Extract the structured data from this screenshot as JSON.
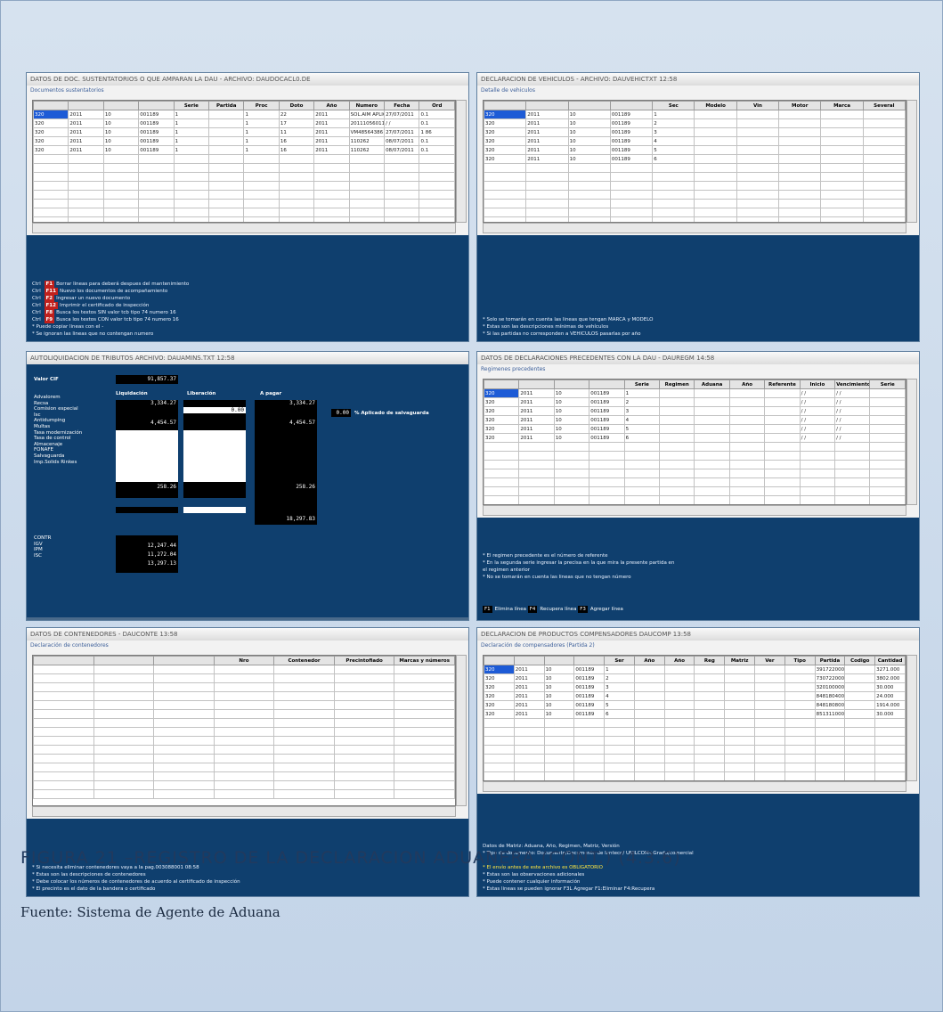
{
  "figure": {
    "caption": "FIGURA 21 –REGISTRO DE LA DECLARACION ADUANERA  (CONT.) (4.3.6)",
    "source": "Fuente: Sistema de Agente de Aduana"
  },
  "panels": {
    "p1": {
      "title": "DATOS DE DOC. SUSTENTATORIOS O QUE AMPARAN LA DAU - ARCHIVO: DAUDOCACL0.DE",
      "section": "Documentos sustentatorios",
      "columns": [
        "",
        "",
        "",
        "",
        "Serie",
        "Partida",
        "Proc",
        "Doto",
        "Año",
        "Numero",
        "Fecha",
        "Ord"
      ],
      "rows": [
        [
          "320",
          "2011",
          "10",
          "001189",
          "1",
          "",
          "1",
          "22",
          "2011",
          "SOL.AIM APLICACION 9210912",
          "27/07/2011",
          "0.1"
        ],
        [
          "320",
          "2011",
          "10",
          "001189",
          "1",
          "",
          "1",
          "17",
          "2011",
          "2011105601186",
          "/ /",
          "0.1"
        ],
        [
          "320",
          "2011",
          "10",
          "001189",
          "1",
          "",
          "1",
          "11",
          "2011",
          "VM48564386",
          "27/07/2011",
          "1 86"
        ],
        [
          "320",
          "2011",
          "10",
          "001189",
          "1",
          "",
          "1",
          "16",
          "2011",
          "110262",
          "08/07/2011",
          "0.1"
        ],
        [
          "320",
          "2011",
          "10",
          "001189",
          "1",
          "",
          "1",
          "16",
          "2011",
          "110262",
          "08/07/2011",
          "0.1"
        ]
      ],
      "notes": [
        {
          "key": "F1",
          "text": "Ctrl  Borrar lineas para deberá despues del mantenimiento"
        },
        {
          "key": "F11",
          "text": "Ctrl  Nuevo los documentos de acompañamiento"
        },
        {
          "key": "F2",
          "text": "Ctrl  Ingresar un nuevo documento"
        },
        {
          "key": "F12",
          "text": "Ctrl  Imprimir el certificado de inspección"
        },
        {
          "key": "F8",
          "text": "Ctrl  Busca los textos SIN valor tcb tipo 74 numero 16"
        },
        {
          "key": "F9",
          "text": "Ctrl  Busca los textos CON valor tcb tipo 74 numero 16"
        },
        {
          "key": "",
          "text": "* Puede copiar lineas con el -"
        },
        {
          "key": "",
          "text": "* Se ignoran las lineas que no contengan numero"
        }
      ]
    },
    "p2": {
      "title": "DECLARACION DE VEHICULOS - ARCHIVO: DAUVEHICTXT 12:58",
      "section": "Detalle de vehiculos",
      "columns": [
        "",
        "",
        "",
        "",
        "Sec",
        "Modelo",
        "Vin",
        "Motor",
        "Marca",
        "Several"
      ],
      "rows": [
        [
          "320",
          "2011",
          "10",
          "001189",
          "1",
          "",
          "",
          "",
          "",
          ""
        ],
        [
          "320",
          "2011",
          "10",
          "001189",
          "2",
          "",
          "",
          "",
          "",
          ""
        ],
        [
          "320",
          "2011",
          "10",
          "001189",
          "3",
          "",
          "",
          "",
          "",
          ""
        ],
        [
          "320",
          "2011",
          "10",
          "001189",
          "4",
          "",
          "",
          "",
          "",
          ""
        ],
        [
          "320",
          "2011",
          "10",
          "001189",
          "5",
          "",
          "",
          "",
          "",
          ""
        ],
        [
          "320",
          "2011",
          "10",
          "001189",
          "6",
          "",
          "",
          "",
          "",
          ""
        ]
      ],
      "notes": [
        "* Solo se tomarán en cuenta las lineas que tengan MARCA y MODELO",
        "* Estas son las descripciones mínimas de vehículos",
        "* Si las partidas no corresponden a VEHICULOS pasarlas por año"
      ]
    },
    "p3": {
      "title": "AUTOLIQUIDACION DE TRIBUTOS  ARCHIVO: DAUAMINS.TXT 12:58",
      "valor_label": "Valor CIF",
      "valor": "91,857.37",
      "headers": {
        "liq": "Liquidación",
        "lib": "Liberación",
        "pagar": "A pagar"
      },
      "labels": [
        "Advalorem",
        "Recsa",
        "Comision especial",
        "Isc",
        "Antidumping",
        "Multas",
        "Tasa modernización",
        "Tasa de control",
        "Almacenaje",
        "FONAFE",
        "Salvaguarda",
        "Imp.Solids Rinkes"
      ],
      "advalorem_liq": "3,334.27",
      "advalorem_pagar": "3,334.27",
      "recsa_lib": "0.00",
      "isc_liq": "4,454.57",
      "isc_pagar": "4,454.57",
      "fonafe_liq": "258.26",
      "fonafe_pagar": "258.26",
      "total_pagar": "18,297.83",
      "pct_value": "0.00",
      "pct_label": "% Aplicado de salvaguarda",
      "bottom_labels": [
        "CONTR",
        "IGV",
        "IPM",
        "ISC"
      ],
      "bottom_values": [
        "12,247.44",
        "11,272.04",
        "13,297.13"
      ]
    },
    "p4": {
      "title": "DATOS DE DECLARACIONES PRECEDENTES CON LA DAU - DAUREGM 14:58",
      "section": "Regimenes precedentes",
      "columns": [
        "",
        "",
        "",
        "",
        "Serie",
        "Regimen",
        "Aduana",
        "Año",
        "Referente",
        "Inicio",
        "Vencimiento",
        "Serie"
      ],
      "rows": [
        [
          "320",
          "2011",
          "10",
          "001189",
          "1",
          "",
          "",
          "",
          "",
          "/ /",
          "/ /",
          ""
        ],
        [
          "320",
          "2011",
          "10",
          "001189",
          "2",
          "",
          "",
          "",
          "",
          "/ /",
          "/ /",
          ""
        ],
        [
          "320",
          "2011",
          "10",
          "001189",
          "3",
          "",
          "",
          "",
          "",
          "/ /",
          "/ /",
          ""
        ],
        [
          "320",
          "2011",
          "10",
          "001189",
          "4",
          "",
          "",
          "",
          "",
          "/ /",
          "/ /",
          ""
        ],
        [
          "320",
          "2011",
          "10",
          "001189",
          "5",
          "",
          "",
          "",
          "",
          "/ /",
          "/ /",
          ""
        ],
        [
          "320",
          "2011",
          "10",
          "001189",
          "6",
          "",
          "",
          "",
          "",
          "/ /",
          "/ /",
          ""
        ]
      ],
      "notes": [
        "* El regimen precedente es el número de referente",
        "* En la segunda serie ingresar la precisa en la que mira la presente partida en",
        "  el regimen anterior",
        "* No se tomarán en cuenta las lineas que no tengan número"
      ],
      "fkeys": [
        {
          "key": "F1",
          "label": "Elimina línea"
        },
        {
          "key": "F4",
          "label": "Recupera línea"
        },
        {
          "key": "F3",
          "label": "Agregar línea"
        }
      ]
    },
    "p5": {
      "title": "DATOS DE CONTENEDORES - DAUCONTE 13:58",
      "section": "Declaración de contenedores",
      "columns": [
        "",
        "",
        "",
        "Nro",
        "Contenedor",
        "Precintofiado",
        "Marcas y números"
      ],
      "rows": 15,
      "notes": [
        "* Si necesita eliminar contenedores vaya a la pag.003088001 08:58",
        "* Estas son las descripciones de contenedores",
        "* Debe colocar los números de contenedores de acuerdo al certificado de inspección",
        "* El precinto es el dato de la bandera o certificado"
      ]
    },
    "p6": {
      "title": "DECLARACION DE PRODUCTOS COMPENSADORES DAUCOMP 13:58",
      "section": "Declaración de compensadores (Partida 2)",
      "columns": [
        "",
        "",
        "",
        "",
        "Ser",
        "Año",
        "Año",
        "Reg",
        "Matriz",
        "Ver",
        "Tipo",
        "Partida",
        "Codigo",
        "Cantidad"
      ],
      "rows": [
        [
          "320",
          "2011",
          "10",
          "001189",
          "1",
          "",
          "",
          "",
          "",
          "",
          "",
          "3917220000",
          "",
          "3271.000"
        ],
        [
          "320",
          "2011",
          "10",
          "001189",
          "2",
          "",
          "",
          "",
          "",
          "",
          "",
          "7307220000",
          "",
          "3802.000"
        ],
        [
          "320",
          "2011",
          "10",
          "001189",
          "3",
          "",
          "",
          "",
          "",
          "",
          "",
          "3201000000",
          "",
          "30.000"
        ],
        [
          "320",
          "2011",
          "10",
          "001189",
          "4",
          "",
          "",
          "",
          "",
          "",
          "",
          "8481804000",
          "",
          "24.000"
        ],
        [
          "320",
          "2011",
          "10",
          "001189",
          "5",
          "",
          "",
          "",
          "",
          "",
          "",
          "8481808000",
          "",
          "1914.000"
        ],
        [
          "320",
          "2011",
          "10",
          "001189",
          "6",
          "",
          "",
          "",
          "",
          "",
          "",
          "8513110000",
          "",
          "30.000"
        ]
      ],
      "notes": [
        "Datos de Matriz: Aduana, Año, Regimen, Matriz, Versión",
        "* Tipo de documento: Documento/Documento de lanteco/ UNILCOM+Grado/comercial",
        "",
        "* El envío antes de este archivo es OBLIGATORIO",
        "* Estas son las observaciones adicionales",
        "* Puede contener cualquier información",
        "* Estas lineas se pueden ignorar F3L Agregar F1:Eliminar F4:Recupera"
      ]
    }
  }
}
